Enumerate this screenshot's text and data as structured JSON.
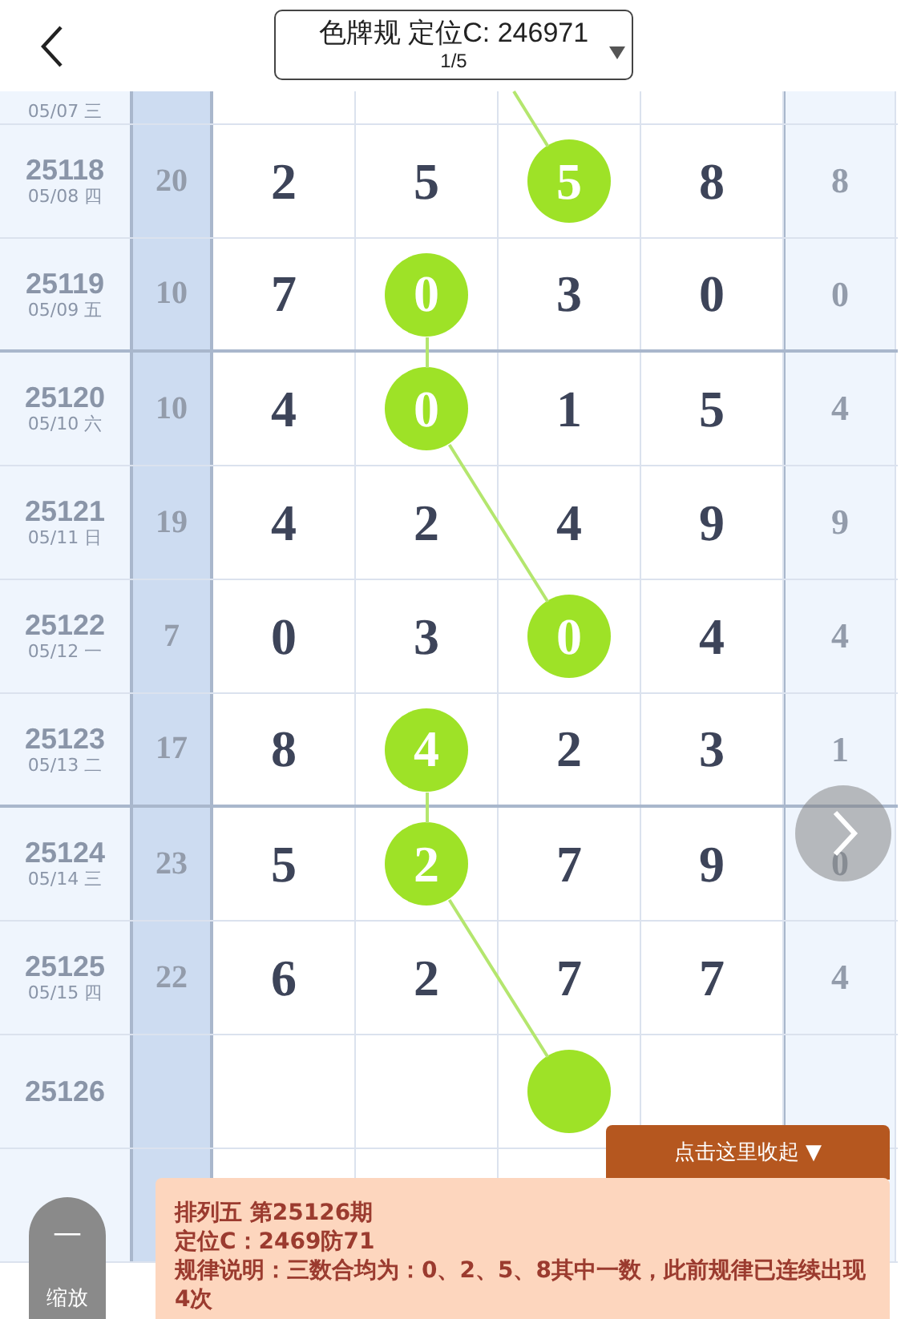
{
  "header": {
    "title": "色牌规 定位C: 246971",
    "page": "1/5"
  },
  "partial_row": {
    "date": "05/07 三"
  },
  "rows": [
    {
      "issue": "25118",
      "date": "05/08 四",
      "sum": "20",
      "digits": [
        {
          "value": "2",
          "highlighted": false
        },
        {
          "value": "5",
          "highlighted": false
        },
        {
          "value": "5",
          "highlighted": true
        },
        {
          "value": "8",
          "highlighted": false
        }
      ],
      "line_from_prev": true,
      "tail": "8"
    },
    {
      "issue": "25119",
      "date": "05/09 五",
      "sum": "10",
      "digits": [
        {
          "value": "7",
          "highlighted": false
        },
        {
          "value": "0",
          "highlighted": true
        },
        {
          "value": "3",
          "highlighted": false
        },
        {
          "value": "0",
          "highlighted": false
        }
      ],
      "line_from_prev": false,
      "tail": "0"
    },
    {
      "issue": "25120",
      "date": "05/10 六",
      "sum": "10",
      "digits": [
        {
          "value": "4",
          "highlighted": false
        },
        {
          "value": "0",
          "highlighted": true
        },
        {
          "value": "1",
          "highlighted": false
        },
        {
          "value": "5",
          "highlighted": false
        }
      ],
      "line_from_prev": true,
      "tail": "4"
    },
    {
      "issue": "25121",
      "date": "05/11 日",
      "sum": "19",
      "digits": [
        {
          "value": "4",
          "highlighted": false
        },
        {
          "value": "2",
          "highlighted": false
        },
        {
          "value": "4",
          "highlighted": false
        },
        {
          "value": "9",
          "highlighted": false
        }
      ],
      "tail": "9"
    },
    {
      "issue": "25122",
      "date": "05/12 一",
      "sum": "7",
      "digits": [
        {
          "value": "0",
          "highlighted": false
        },
        {
          "value": "3",
          "highlighted": false
        },
        {
          "value": "0",
          "highlighted": true
        },
        {
          "value": "4",
          "highlighted": false
        }
      ],
      "line_from_prev": true,
      "tail": "4"
    },
    {
      "issue": "25123",
      "date": "05/13 二",
      "sum": "17",
      "digits": [
        {
          "value": "8",
          "highlighted": false
        },
        {
          "value": "4",
          "highlighted": true
        },
        {
          "value": "2",
          "highlighted": false
        },
        {
          "value": "3",
          "highlighted": false
        }
      ],
      "line_from_prev": false,
      "tail": "1"
    },
    {
      "issue": "25124",
      "date": "05/14 三",
      "sum": "23",
      "digits": [
        {
          "value": "5",
          "highlighted": false
        },
        {
          "value": "2",
          "highlighted": true
        },
        {
          "value": "7",
          "highlighted": false
        },
        {
          "value": "9",
          "highlighted": false
        }
      ],
      "line_from_prev": true,
      "tail": "0"
    },
    {
      "issue": "25125",
      "date": "05/15 四",
      "sum": "22",
      "digits": [
        {
          "value": "6",
          "highlighted": false
        },
        {
          "value": "2",
          "highlighted": false
        },
        {
          "value": "7",
          "highlighted": false
        },
        {
          "value": "7",
          "highlighted": false
        }
      ],
      "tail": "4"
    },
    {
      "issue": "25126",
      "digits": [
        {
          "highlighted": false
        },
        {
          "highlighted": false
        },
        {
          "highlighted": true
        },
        {
          "highlighted": false
        }
      ],
      "line_from_prev": true
    }
  ],
  "collapse_button": "点击这里收起 ▼",
  "panel": {
    "title": "排列五 第25126期",
    "position": "定位C：2469防71",
    "rule": "规律说明：三数合均为：0、2、5、8其中一数，此前规律已连续出现4次"
  },
  "zoom_button": {
    "icon": "—",
    "label": "缩放"
  }
}
